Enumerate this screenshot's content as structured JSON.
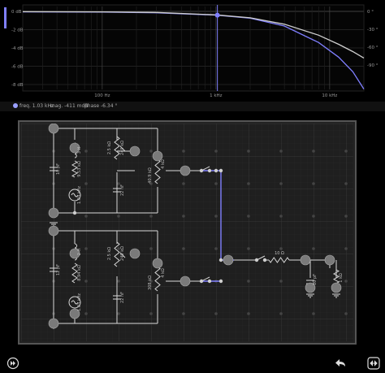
{
  "chart_data": {
    "type": "line",
    "title": "",
    "xlabel": "",
    "ylabel": "",
    "x_scale": "log",
    "x_ticks": [
      "100 Hz",
      "1 kHz",
      "10 kHz"
    ],
    "y_left_ticks": [
      "0 dB",
      "-2 dB",
      "-4 dB",
      "-6 dB",
      "-8 dB"
    ],
    "y_right_ticks": [
      "0 °",
      "-30 °",
      "-60 °",
      "-90 °"
    ],
    "ylim_db": [
      -8.5,
      0
    ],
    "series": [
      {
        "color": "#7f7fff",
        "x_hz": [
          20,
          100,
          300,
          1000,
          2000,
          4000,
          8000,
          12000,
          16000,
          20000
        ],
        "y_db": [
          -0.05,
          -0.07,
          -0.15,
          -0.41,
          -0.75,
          -1.6,
          -3.4,
          -5.0,
          -6.6,
          -8.5
        ]
      },
      {
        "color": "#cfcfcf",
        "x_hz": [
          20,
          100,
          300,
          1000,
          2000,
          4000,
          8000,
          12000,
          16000,
          20000
        ],
        "y_db": [
          -0.03,
          -0.05,
          -0.12,
          -0.38,
          -0.7,
          -1.4,
          -2.6,
          -3.6,
          -4.4,
          -5.1
        ]
      }
    ],
    "cursor_hz": 1030
  },
  "status": {
    "freq": "freq. 1.03 kHz",
    "mag": "mag. -411 mdB",
    "phase": "phase -6.34 °"
  },
  "components": {
    "c_top": "10 pF",
    "l_top": "3 H",
    "r_top_mid": "9.53 kΩ",
    "src_top": "1.03 kHz",
    "pot_top": "2.5 kΩ",
    "pot_top_r": "249 kΩ",
    "c_top_b": "22 nF",
    "r_top_right": "4 kΩ",
    "r_top_right2": "40.9 kΩ",
    "c_bot": "12 pF",
    "l_bot": "2 H",
    "r_bot_mid": "8.94 kΩ",
    "src_bot": "1.03 kHz",
    "pot_bot": "2.5 kΩ",
    "pot_bot_r": "249 kΩ",
    "c_bot_b": "22 nF",
    "r_bot_right": "4 kΩ",
    "r_bot_right2": "308 kΩ",
    "r_series": "10 Ω",
    "c_out": "10 pF",
    "r_out": "1 kΩ"
  },
  "colors": {
    "accent": "#8080ff",
    "wire": "#d8d8d8",
    "grid": "#3a3a3a"
  },
  "icons": {
    "left": "fast-forward-icon",
    "undo": "undo-icon",
    "right": "swap-icon"
  }
}
